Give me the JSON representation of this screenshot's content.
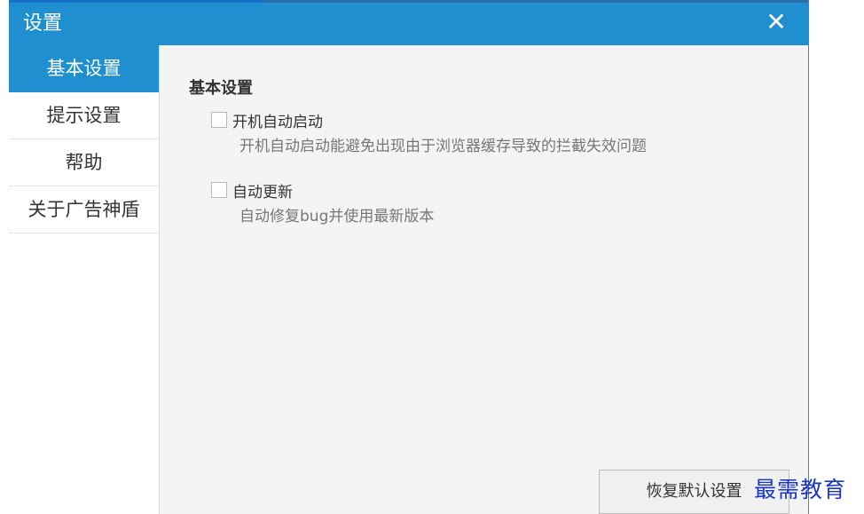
{
  "window": {
    "title": "设置",
    "close_icon": "close-icon",
    "accent_color": "#1f8fcf"
  },
  "sidebar": {
    "items": [
      {
        "label": "基本设置",
        "active": true
      },
      {
        "label": "提示设置",
        "active": false
      },
      {
        "label": "帮助",
        "active": false
      },
      {
        "label": "关于广告神盾",
        "active": false
      }
    ]
  },
  "main": {
    "section_title": "基本设置",
    "options": [
      {
        "label": "开机自动启动",
        "description": "开机自动启动能避免出现由于浏览器缓存导致的拦截失效问题",
        "checked": false
      },
      {
        "label": "自动更新",
        "description": "自动修复bug并使用最新版本",
        "checked": false
      }
    ],
    "reset_label": "恢复默认设置"
  },
  "watermark": {
    "text": "最需教育"
  }
}
